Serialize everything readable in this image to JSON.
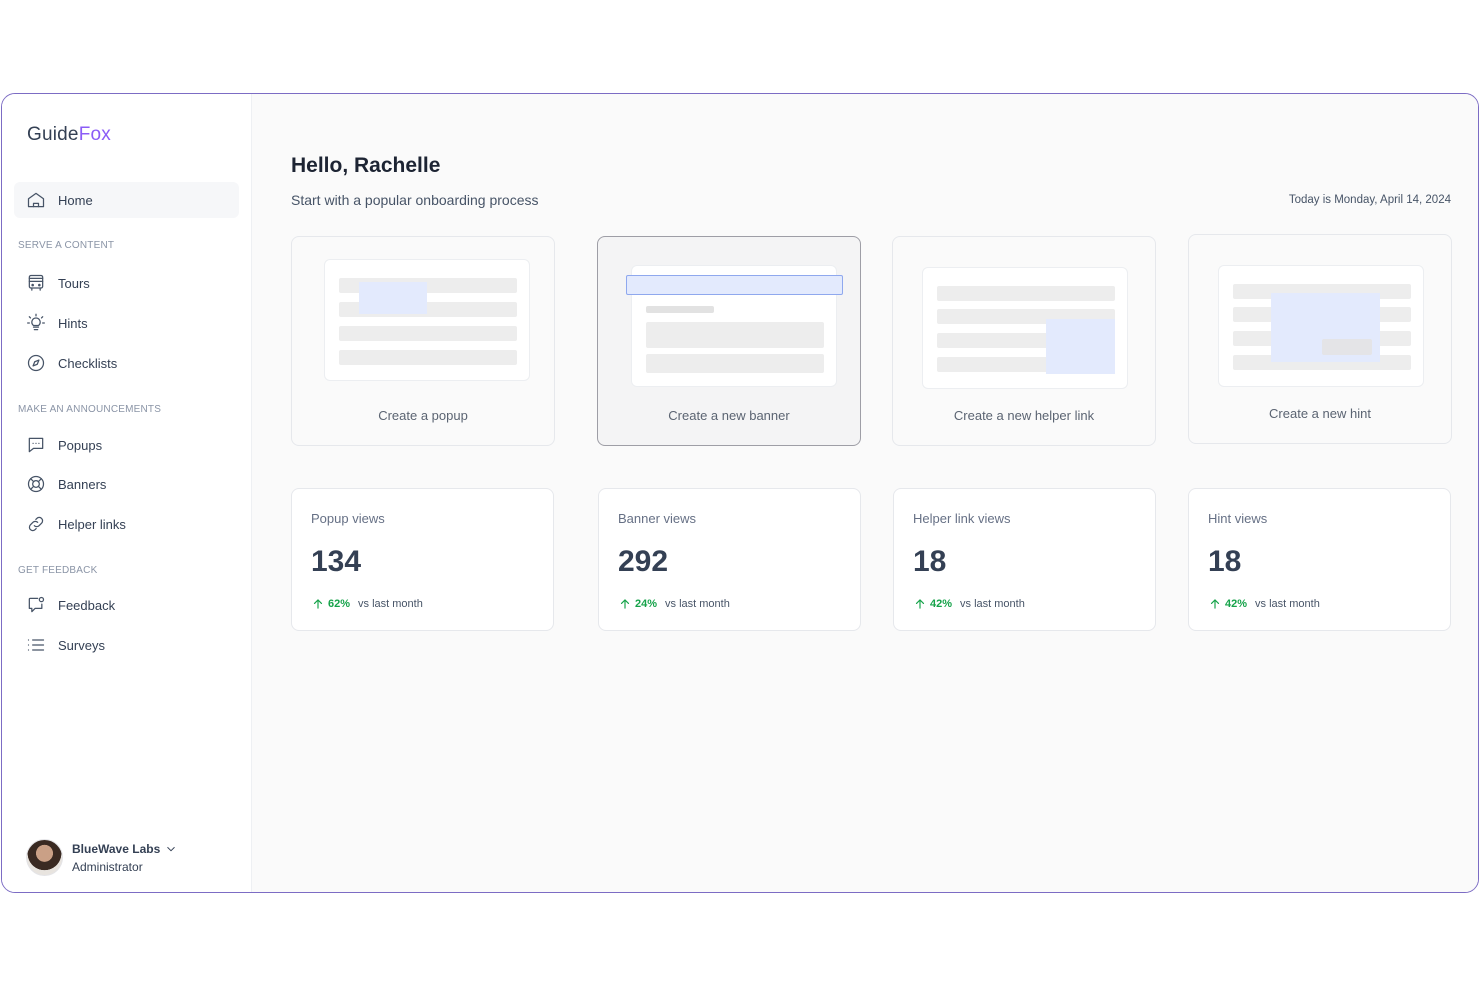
{
  "brand": {
    "part1": "Guide",
    "part2": "Fox",
    "accent_color": "#8b5cf6"
  },
  "sidebar": {
    "home": {
      "label": "Home",
      "icon": "home-icon"
    },
    "sections": {
      "serve": "SERVE A CONTENT",
      "announce": "MAKE AN ANNOUNCEMENTS",
      "feedback": "GET FEEDBACK"
    },
    "items": {
      "tours": {
        "label": "Tours",
        "icon": "bus-icon"
      },
      "hints": {
        "label": "Hints",
        "icon": "lightbulb-icon"
      },
      "checklists": {
        "label": "Checklists",
        "icon": "compass-icon"
      },
      "popups": {
        "label": "Popups",
        "icon": "message-icon"
      },
      "banners": {
        "label": "Banners",
        "icon": "lifebuoy-icon"
      },
      "helper_links": {
        "label": "Helper links",
        "icon": "link-icon"
      },
      "feedback": {
        "label": "Feedback",
        "icon": "feedback-icon"
      },
      "surveys": {
        "label": "Surveys",
        "icon": "list-icon"
      }
    },
    "profile": {
      "org": "BlueWave Labs",
      "role": "Administrator"
    }
  },
  "main": {
    "greeting": "Hello, Rachelle",
    "subtitle": "Start with a popular onboarding process",
    "today": "Today is Monday, April 14, 2024",
    "create_cards": [
      {
        "label": "Create a popup"
      },
      {
        "label": "Create a new banner"
      },
      {
        "label": "Create a new helper link"
      },
      {
        "label": "Create a new hint"
      }
    ],
    "stats": [
      {
        "title": "Popup views",
        "value": "134",
        "change": "62%",
        "compare": "vs last month"
      },
      {
        "title": "Banner views",
        "value": "292",
        "change": "24%",
        "compare": "vs last month"
      },
      {
        "title": "Helper link views",
        "value": "18",
        "change": "42%",
        "compare": "vs last month"
      },
      {
        "title": "Hint views",
        "value": "18",
        "change": "42%",
        "compare": "vs last month"
      }
    ],
    "trend_color": "#16a34a"
  }
}
